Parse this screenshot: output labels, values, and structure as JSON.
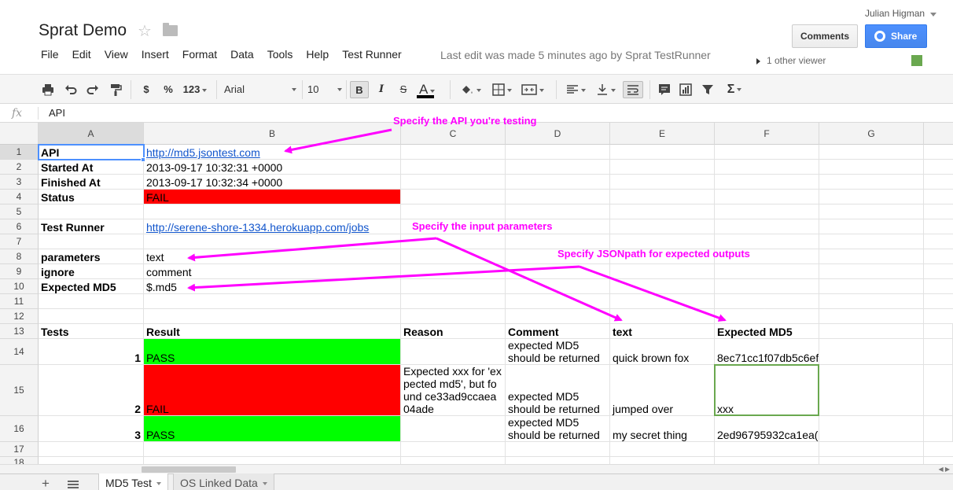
{
  "header": {
    "doc_title": "Sprat Demo",
    "menus": [
      "File",
      "Edit",
      "View",
      "Insert",
      "Format",
      "Data",
      "Tools",
      "Help",
      "Test Runner"
    ],
    "last_edit": "Last edit was made 5 minutes ago by Sprat TestRunner",
    "user_name": "Julian Higman",
    "comments_label": "Comments",
    "share_label": "Share",
    "viewers": "1 other viewer"
  },
  "toolbar": {
    "currency": "$",
    "percent": "%",
    "number_format": "123",
    "font": "Arial",
    "font_size": "10",
    "bold": "B",
    "italic": "I",
    "strike": "S",
    "text_color": "A",
    "sum": "Σ"
  },
  "formula_bar": {
    "fx": "fx",
    "value": "API"
  },
  "columns": [
    "A",
    "B",
    "C",
    "D",
    "E",
    "F",
    "G"
  ],
  "rows": [
    "1",
    "2",
    "3",
    "4",
    "5",
    "6",
    "7",
    "8",
    "9",
    "10",
    "11",
    "12",
    "13",
    "14",
    "15",
    "16",
    "17",
    "18"
  ],
  "cells": {
    "A1": "API",
    "B1": "http://md5.jsontest.com",
    "A2": "Started At",
    "B2": "2013-09-17 10:32:31 +0000",
    "A3": "Finished At",
    "B3": "2013-09-17 10:32:34 +0000",
    "A4": "Status",
    "B4": "FAIL",
    "A6": "Test Runner",
    "B6": "http://serene-shore-1334.herokuapp.com/jobs",
    "A8": "parameters",
    "B8": "text",
    "A9": "ignore",
    "B9": "comment",
    "A10": "Expected MD5",
    "B10": "$.md5",
    "A13": "Tests",
    "B13": "Result",
    "C13": "Reason",
    "D13": "Comment",
    "E13": "text",
    "F13": "Expected MD5",
    "A14": "1",
    "B14": "PASS",
    "D14": "expected MD5 should be returned",
    "E14": "quick brown fox",
    "F14": "8ec71cc1f07db5c6ef",
    "A15": "2",
    "B15": "FAIL",
    "C15": "Expected xxx for 'expected md5', but found ce33ad9ccaea04ade",
    "D15": "expected MD5 should be returned",
    "E15": "jumped over",
    "F15": "xxx",
    "A16": "3",
    "B16": "PASS",
    "D16": "expected MD5 should be returned",
    "E16": "my secret thing",
    "F16": "2ed96795932ca1ea("
  },
  "annotations": {
    "api": "Specify the API you're testing",
    "inputs": "Specify the input parameters",
    "outputs": "Specify JSONpath for expected outputs"
  },
  "colors": {
    "fail": "#ff0000",
    "pass": "#00ff00",
    "annotation": "#ff00ff",
    "link": "#1155cc"
  },
  "sheet_tabs": [
    "MD5 Test",
    "OS Linked Data"
  ]
}
